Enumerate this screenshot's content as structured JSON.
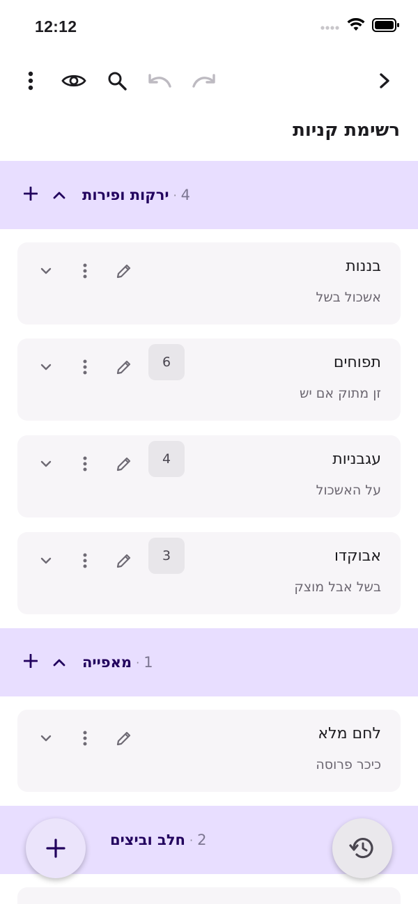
{
  "status": {
    "time": "12:12"
  },
  "toolbar": {
    "icons": [
      "more-vert-icon",
      "eye-icon",
      "search-icon",
      "undo-icon",
      "redo-icon",
      "chevron-right-icon"
    ]
  },
  "page": {
    "title": "רשימת קניות"
  },
  "sections": [
    {
      "name": "ירקות ופירות",
      "count": "4",
      "dot": "·",
      "items": [
        {
          "name": "בננות",
          "note": "אשכול בשל",
          "qty": ""
        },
        {
          "name": "תפוחים",
          "note": "זן מתוק אם יש",
          "qty": "6"
        },
        {
          "name": "עגבניות",
          "note": "על האשכול",
          "qty": "4"
        },
        {
          "name": "אבוקדו",
          "note": "בשל אבל מוצק",
          "qty": "3"
        }
      ]
    },
    {
      "name": "מאפייה",
      "count": "1",
      "dot": "·",
      "items": [
        {
          "name": "לחם מלא",
          "note": "כיכר פרוסה",
          "qty": ""
        }
      ]
    },
    {
      "name": "חלב וביצים",
      "count": "2",
      "dot": "·",
      "items": []
    }
  ],
  "colors": {
    "section_bg": "#e8deff",
    "section_text": "#21005d",
    "card_bg": "#f7f5f8",
    "icon": "#6e6a74",
    "disabled_icon": "#bdbac1"
  }
}
